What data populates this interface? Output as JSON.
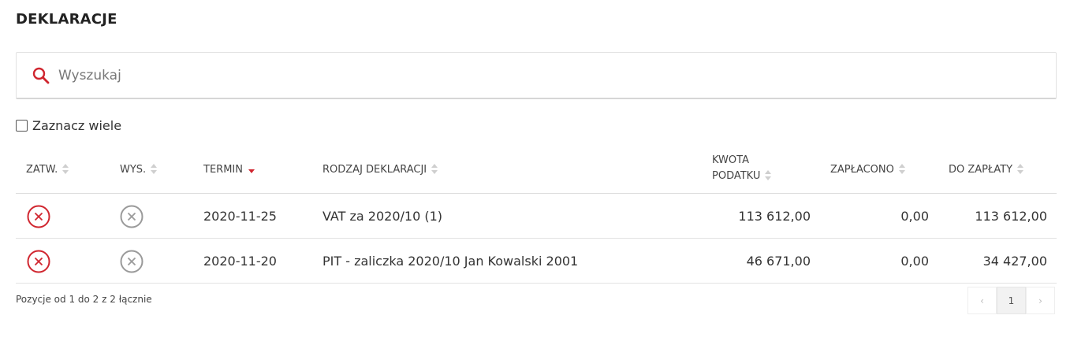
{
  "header": {
    "title": "DEKLARACJE"
  },
  "search": {
    "placeholder": "Wyszukaj",
    "value": ""
  },
  "select_many": {
    "label": "Zaznacz wiele",
    "checked": false
  },
  "table": {
    "columns": [
      {
        "key": "zatw",
        "label": "ZATW.",
        "sort": "none"
      },
      {
        "key": "wys",
        "label": "WYS.",
        "sort": "none"
      },
      {
        "key": "termin",
        "label": "TERMIN",
        "sort": "desc"
      },
      {
        "key": "rodzaj",
        "label": "RODZAJ DEKLARACJI",
        "sort": "none"
      },
      {
        "key": "kwota",
        "label_line1": "KWOTA",
        "label_line2": "PODATKU",
        "sort": "none"
      },
      {
        "key": "zaplacono",
        "label": "ZAPŁACONO",
        "sort": "none"
      },
      {
        "key": "do_zaplaty",
        "label": "DO ZAPŁATY",
        "sort": "none"
      }
    ],
    "rows": [
      {
        "zatw": "not-approved",
        "wys": "not-sent",
        "termin": "2020-11-25",
        "rodzaj": "VAT za 2020/10 (1)",
        "kwota": "113 612,00",
        "zaplacono": "0,00",
        "do_zaplaty": "113 612,00"
      },
      {
        "zatw": "not-approved",
        "wys": "not-sent",
        "termin": "2020-11-20",
        "rodzaj": "PIT - zaliczka 2020/10 Jan Kowalski 2001",
        "kwota": "46 671,00",
        "zaplacono": "0,00",
        "do_zaplaty": "34 427,00"
      }
    ]
  },
  "footer": {
    "info": "Pozycje od 1 do 2 z 2 łącznie",
    "pagination": {
      "prev": "‹",
      "current": "1",
      "next": "›"
    }
  },
  "icons": {
    "search": "search-icon",
    "sort": "sort-icon",
    "sort_desc": "sort-desc-icon",
    "not_approved": "x-circle-red-icon",
    "not_sent": "x-circle-gray-icon"
  },
  "colors": {
    "accent_red": "#d0262f",
    "gray_icon": "#9a9a9a",
    "sort_gray": "#cfcfcf"
  }
}
